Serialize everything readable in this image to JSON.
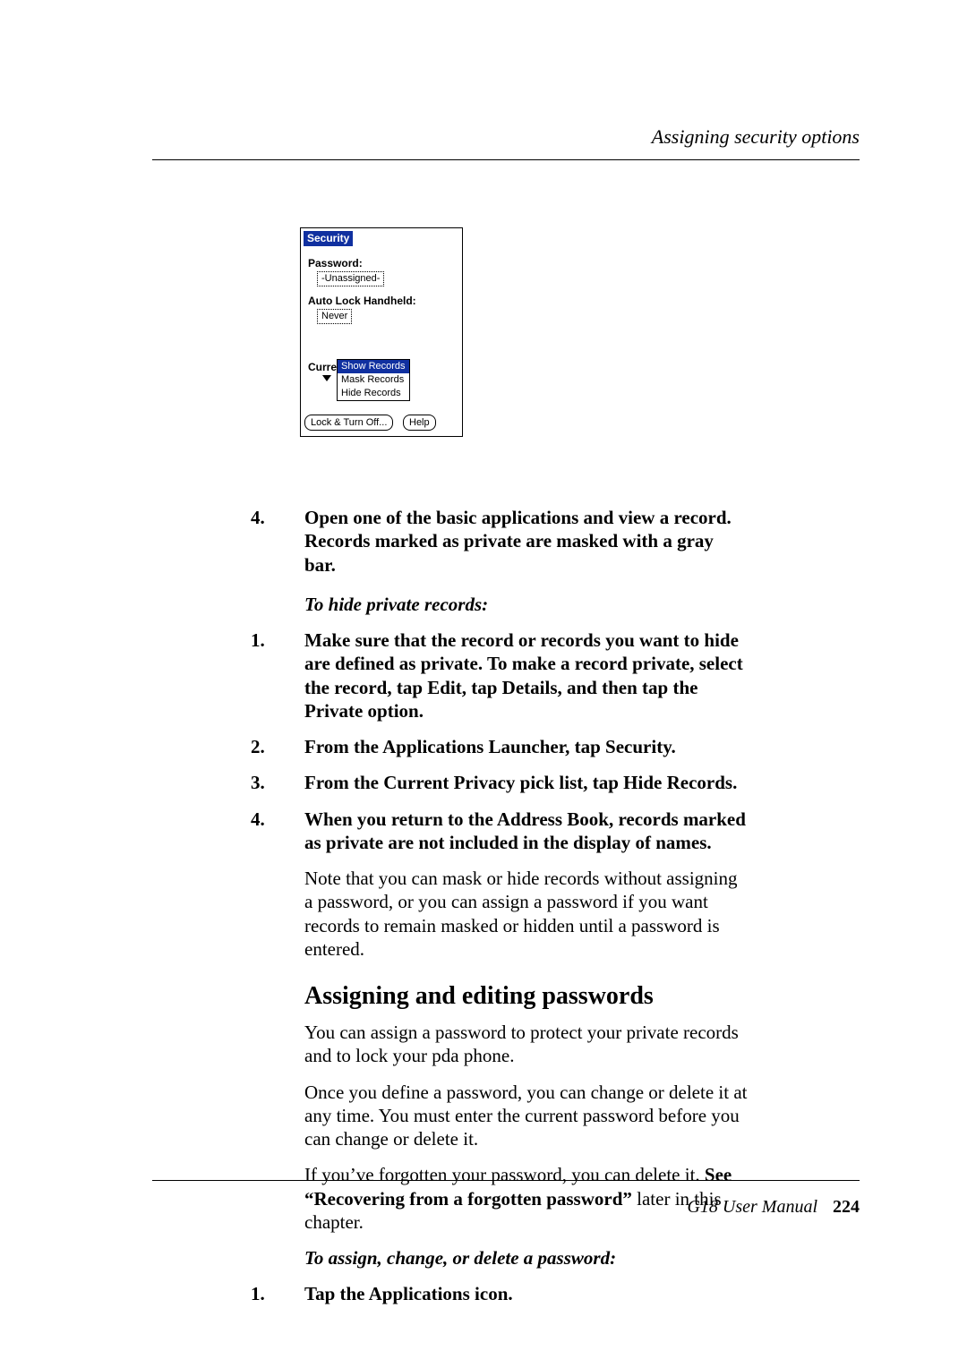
{
  "header": {
    "running_head": "Assigning security options"
  },
  "palm": {
    "title": "Security",
    "password_label": "Password:",
    "password_value": "-Unassigned-",
    "autolock_label": "Auto Lock Handheld:",
    "autolock_value": "Never",
    "curre_label": "Curre",
    "dropdown": {
      "opt1": "Show Records",
      "opt2": "Mask Records",
      "opt3": "Hide Records"
    },
    "lock_btn": "Lock & Turn Off...",
    "help_btn": "Help"
  },
  "steps_a": {
    "n4": "4.",
    "t4": "Open one of the basic applications and view a record. Records marked as private are masked with a gray bar."
  },
  "subhead1": "To hide private records:",
  "steps_b": {
    "n1": "1.",
    "t1": "Make sure that the record or records you want to hide are defined as private. To make a record private, select the record, tap Edit, tap Details, and then tap the Private option.",
    "n2": "2.",
    "t2": "From the Applications Launcher, tap Security.",
    "n3": "3.",
    "t3": "From the Current Privacy pick list, tap Hide Records.",
    "n4": "4.",
    "t4": "When you return to the Address Book, records marked as private are not included in the display of names."
  },
  "note": "Note that you can mask or hide records without assigning a password, or you can assign a password if you want records to remain masked or hidden until a password is entered.",
  "h3": "Assigning and editing passwords",
  "para1": "You can assign a password to protect your private records and to lock your pda phone.",
  "para2": "Once you define a password, you can change or delete it at any time. You must enter the current password before you can change or delete it.",
  "para3a": "If you’ve forgotten your password, you can delete it. ",
  "para3b": "See “Recovering from a forgotten password”",
  "para3c": " later in this chapter.",
  "subhead2": "To assign, change, or delete a password:",
  "steps_c": {
    "n1": "1.",
    "t1": "Tap the Applications icon."
  },
  "footer": {
    "manual": "G18 User Manual",
    "page": "224"
  }
}
